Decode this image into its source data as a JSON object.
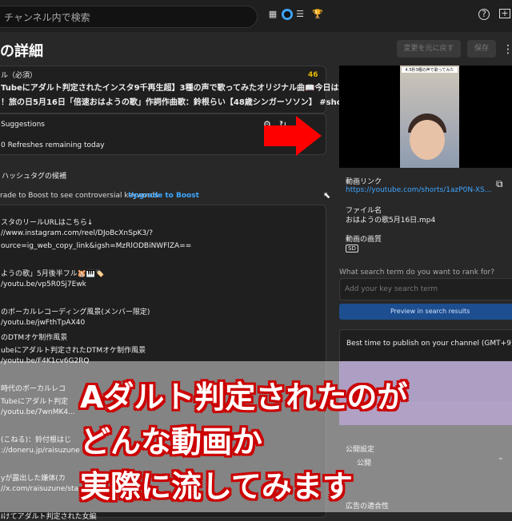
{
  "topbar": {
    "search_placeholder": "チャンネル内で検索",
    "icons": [
      "analytics-icon",
      "studio-icon",
      "menu-icon",
      "trophy-icon",
      "help-icon",
      "create-icon"
    ]
  },
  "page_title": "の詳細",
  "buttons": {
    "undo": "変更を元に戻す",
    "save": "保存",
    "more": "⋮"
  },
  "title_box": {
    "label": "ル（必須）",
    "count": "46",
    "line1": "Tubeにアダルト判定されたインスタ9千再生超】3種の声で歌ってみたオリジナル曲📖今日は",
    "line2": "！旅の日5月16日「倍速おはようの歌」作詞作曲歌：鈴根らい【48歳シンガーソソン】 #shorts"
  },
  "suggestions": {
    "label": "Suggestions",
    "refreshes": "0 Refreshes remaining today"
  },
  "hashtag_hint": "ハッシュタグの候補",
  "upgrade": {
    "text": "rade to Boost to see controversial keywords",
    "link": "Upgrade to Boost"
  },
  "description_lines": [
    "スタのリールURLはこちら↓",
    "//www.instagram.com/reel/DJoBcXnSpK3/?",
    "ource=ig_web_copy_link&igsh=MzRlODBiNWFlZA==",
    "",
    "ようの歌」5月後半フル🐹🎹🏷️",
    "/youtu.be/vp5R0Sj7Ewk",
    "",
    "のボーカルレコーディング風景(メンバー限定)",
    "/youtu.be/jwFthTpAX40",
    "のDTMオケ制作風景",
    "ubeにアダルト判定されたDTMオケ制作風景",
    "/youtu.be/F4K1cv6G2RQ",
    "",
    "時代のボーカルレコ",
    "Tubeにアダルト判定",
    "/youtu.be/7wnMK4...",
    "",
    "(こねる)：鈴付根はじ",
    "://doneru.jp/raisuzune",
    "",
    "yが露出した嫌体(カ",
    "//x.com/raisuzune/sta",
    "",
    "Iけてアダルト判定された女編"
  ],
  "video": {
    "caption": "4.5秒3種の声で歌ってみた"
  },
  "video_link": {
    "label": "動画リンク",
    "url": "https://youtube.com/shorts/1azP0N-XS..."
  },
  "file_name": {
    "label": "ファイル名",
    "value": "おはようの歌5月16日.mp4"
  },
  "quality": {
    "label": "動画の画質",
    "badge": "SD"
  },
  "search_term": {
    "question": "What search term do you want to rank for?",
    "placeholder": "Add your key search term"
  },
  "preview_button": "Preview in search results",
  "best_time": "Best time to publish on your channel (GMT+9)",
  "visibility": {
    "label": "公開設定",
    "value": "公開"
  },
  "restrictions": "広告の適合性",
  "overlay_caption": {
    "line1": "Aダルト判定されたのが",
    "line2": "どんな動画か",
    "line3": "実際に流してみます"
  }
}
